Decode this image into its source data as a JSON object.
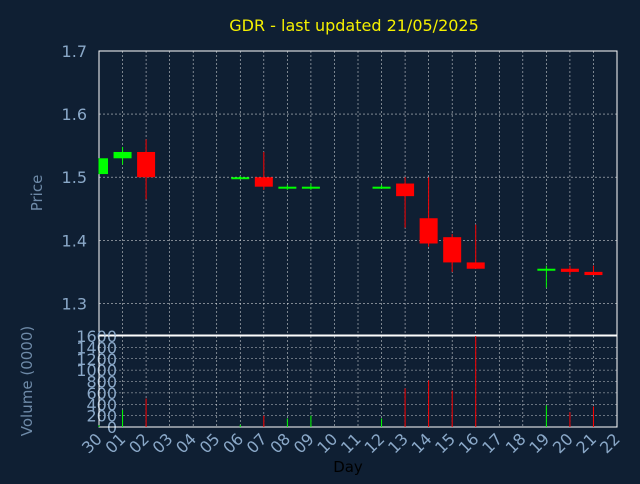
{
  "colors": {
    "background": "#0f1f33",
    "title": "#f5f000",
    "axis_text": "#8aa8c8",
    "axis_label": "#6e8aa8",
    "grid": "#ffffff",
    "frame": "#ffffff",
    "up": "#00ff00",
    "down": "#ff0000"
  },
  "chart_data": [
    {
      "type": "candlestick",
      "title": "GDR - last updated 21/05/2025",
      "ylabel": "Price",
      "ylim": [
        1.25,
        1.7
      ],
      "yticks": [
        "1.3",
        "1.4",
        "1.5",
        "1.6",
        "1.7"
      ],
      "grid": true,
      "x": [
        "30",
        "01",
        "02",
        "03",
        "04",
        "05",
        "06",
        "07",
        "08",
        "09",
        "10",
        "11",
        "12",
        "13",
        "14",
        "15",
        "16",
        "17",
        "18",
        "19",
        "20",
        "21",
        "22"
      ],
      "candles": [
        {
          "x": "30",
          "open": 1.505,
          "high": 1.53,
          "low": 1.505,
          "close": 1.53
        },
        {
          "x": "01",
          "open": 1.53,
          "high": 1.548,
          "low": 1.52,
          "close": 1.54
        },
        {
          "x": "02",
          "open": 1.54,
          "high": 1.56,
          "low": 1.465,
          "close": 1.5
        },
        {
          "x": "06",
          "open": 1.5,
          "high": 1.502,
          "low": 1.497,
          "close": 1.5
        },
        {
          "x": "07",
          "open": 1.5,
          "high": 1.54,
          "low": 1.48,
          "close": 1.485
        },
        {
          "x": "08",
          "open": 1.485,
          "high": 1.488,
          "low": 1.48,
          "close": 1.485
        },
        {
          "x": "09",
          "open": 1.485,
          "high": 1.49,
          "low": 1.48,
          "close": 1.485
        },
        {
          "x": "12",
          "open": 1.485,
          "high": 1.488,
          "low": 1.482,
          "close": 1.485
        },
        {
          "x": "13",
          "open": 1.49,
          "high": 1.5,
          "low": 1.42,
          "close": 1.47
        },
        {
          "x": "14",
          "open": 1.435,
          "high": 1.5,
          "low": 1.39,
          "close": 1.395
        },
        {
          "x": "15",
          "open": 1.405,
          "high": 1.41,
          "low": 1.35,
          "close": 1.365
        },
        {
          "x": "16",
          "open": 1.365,
          "high": 1.425,
          "low": 1.355,
          "close": 1.355
        },
        {
          "x": "19",
          "open": 1.355,
          "high": 1.36,
          "low": 1.325,
          "close": 1.355
        },
        {
          "x": "20",
          "open": 1.355,
          "high": 1.36,
          "low": 1.345,
          "close": 1.35
        },
        {
          "x": "21",
          "open": 1.35,
          "high": 1.36,
          "low": 1.345,
          "close": 1.345
        }
      ]
    },
    {
      "type": "bar",
      "ylabel": "Volume (0000)",
      "xlabel": "Day",
      "ylim": [
        0,
        1600
      ],
      "yticks": [
        "0",
        "200",
        "400",
        "600",
        "800",
        "1000",
        "1200",
        "1400",
        "1600"
      ],
      "x": [
        "30",
        "01",
        "02",
        "03",
        "04",
        "05",
        "06",
        "07",
        "08",
        "09",
        "10",
        "11",
        "12",
        "13",
        "14",
        "15",
        "16",
        "17",
        "18",
        "19",
        "20",
        "21",
        "22"
      ],
      "bars": [
        {
          "x": "30",
          "value": 30,
          "dir": "up"
        },
        {
          "x": "01",
          "value": 300,
          "dir": "up"
        },
        {
          "x": "02",
          "value": 500,
          "dir": "down"
        },
        {
          "x": "06",
          "value": 40,
          "dir": "up"
        },
        {
          "x": "07",
          "value": 200,
          "dir": "down"
        },
        {
          "x": "08",
          "value": 150,
          "dir": "up"
        },
        {
          "x": "09",
          "value": 200,
          "dir": "up"
        },
        {
          "x": "12",
          "value": 150,
          "dir": "up"
        },
        {
          "x": "13",
          "value": 680,
          "dir": "down"
        },
        {
          "x": "14",
          "value": 820,
          "dir": "down"
        },
        {
          "x": "15",
          "value": 640,
          "dir": "down"
        },
        {
          "x": "16",
          "value": 1600,
          "dir": "down"
        },
        {
          "x": "19",
          "value": 380,
          "dir": "up"
        },
        {
          "x": "20",
          "value": 260,
          "dir": "down"
        },
        {
          "x": "21",
          "value": 360,
          "dir": "down"
        }
      ]
    }
  ]
}
